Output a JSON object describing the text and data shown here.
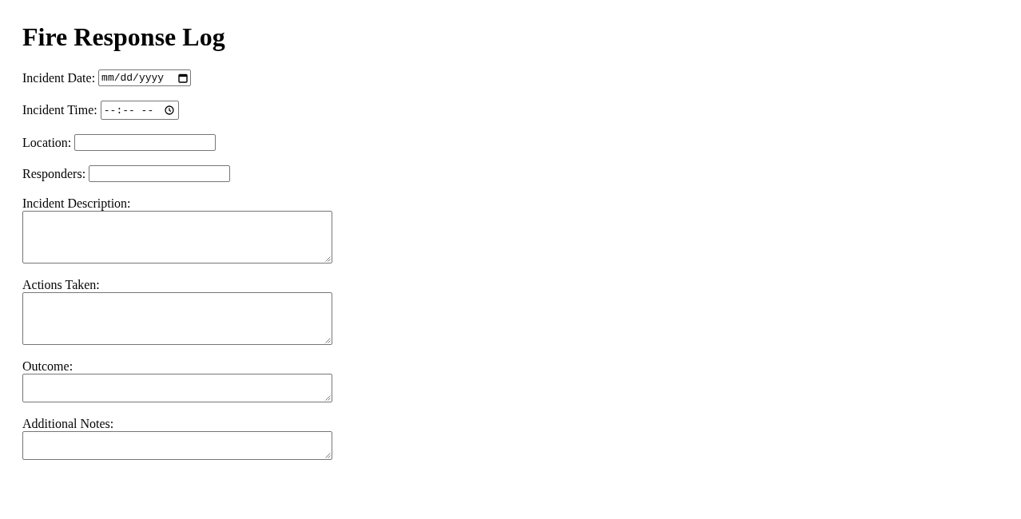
{
  "title": "Fire Response Log",
  "fields": [
    {
      "kind": "date",
      "label": "Incident Date:",
      "placeholder": "mm/dd/yyyy"
    },
    {
      "kind": "time",
      "label": "Incident Time:",
      "placeholder": "--:-- --"
    },
    {
      "kind": "text",
      "label": "Location:"
    },
    {
      "kind": "text",
      "label": "Responders:"
    },
    {
      "kind": "textarea",
      "label": "Incident Description:"
    },
    {
      "kind": "textarea",
      "label": "Actions Taken:"
    },
    {
      "kind": "shortarea",
      "label": "Outcome:"
    },
    {
      "kind": "shortarea",
      "label": "Additional Notes:"
    }
  ]
}
